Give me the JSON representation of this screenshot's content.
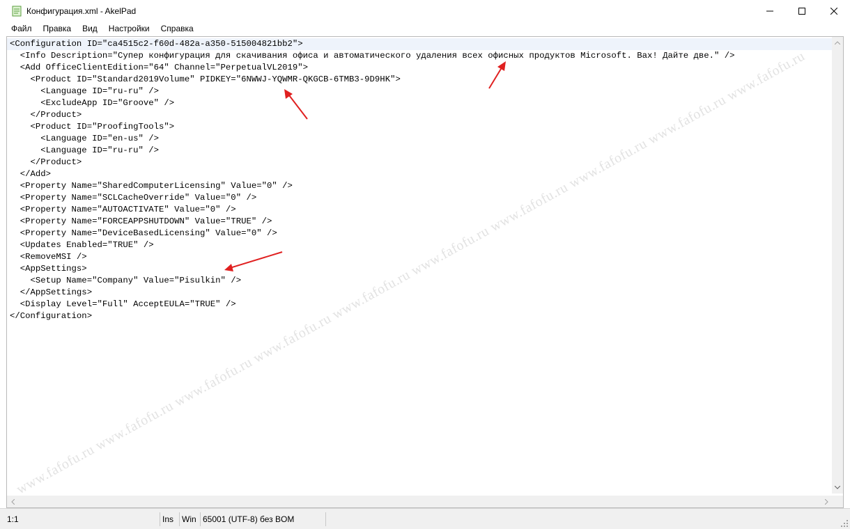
{
  "window": {
    "title": "Конфигурация.xml - AkelPad",
    "minimize_glyph": "—",
    "maximize_glyph": "☐",
    "close_glyph": "✕"
  },
  "menu": [
    "Файл",
    "Правка",
    "Вид",
    "Настройки",
    "Справка"
  ],
  "editor": {
    "lines": [
      "<Configuration ID=\"ca4515c2-f60d-482a-a350-515004821bb2\">",
      "  <Info Description=\"Супер конфигурация для скачивания офиса и автоматического удаления всех офисных продуктов Microsoft. Вах! Дайте две.\" />",
      "  <Add OfficeClientEdition=\"64\" Channel=\"PerpetualVL2019\">",
      "    <Product ID=\"Standard2019Volume\" PIDKEY=\"6NWWJ-YQWMR-QKGCB-6TMB3-9D9HK\">",
      "      <Language ID=\"ru-ru\" />",
      "      <ExcludeApp ID=\"Groove\" />",
      "    </Product>",
      "    <Product ID=\"ProofingTools\">",
      "      <Language ID=\"en-us\" />",
      "      <Language ID=\"ru-ru\" />",
      "    </Product>",
      "  </Add>",
      "  <Property Name=\"SharedComputerLicensing\" Value=\"0\" />",
      "  <Property Name=\"SCLCacheOverride\" Value=\"0\" />",
      "  <Property Name=\"AUTOACTIVATE\" Value=\"0\" />",
      "  <Property Name=\"FORCEAPPSHUTDOWN\" Value=\"TRUE\" />",
      "  <Property Name=\"DeviceBasedLicensing\" Value=\"0\" />",
      "  <Updates Enabled=\"TRUE\" />",
      "  <RemoveMSI />",
      "  <AppSettings>",
      "    <Setup Name=\"Company\" Value=\"Pisulkin\" />",
      "  </AppSettings>",
      "  <Display Level=\"Full\" AcceptEULA=\"TRUE\" />",
      "</Configuration>"
    ]
  },
  "statusbar": {
    "position": "1:1",
    "mode": "Ins",
    "newline": "Win",
    "encoding": "65001 (UTF-8) без BOM"
  },
  "watermark": {
    "text": "www.fafofu.ru www.fafofu.ru www.fafofu.ru www.fafofu.ru www.fafofu.ru www.fafofu.ru www.fafofu.ru www.fafofu.ru www.fafofu.ru www.fafofu.ru"
  },
  "colors": {
    "annotation_arrow": "#e02020",
    "current_line": "#eef3fb"
  },
  "icons": {
    "app": "notepad-document-icon",
    "scroll_up": "arrow-up-icon",
    "scroll_down": "arrow-down-icon",
    "scroll_left": "arrow-left-icon",
    "scroll_right": "arrow-right-icon"
  }
}
